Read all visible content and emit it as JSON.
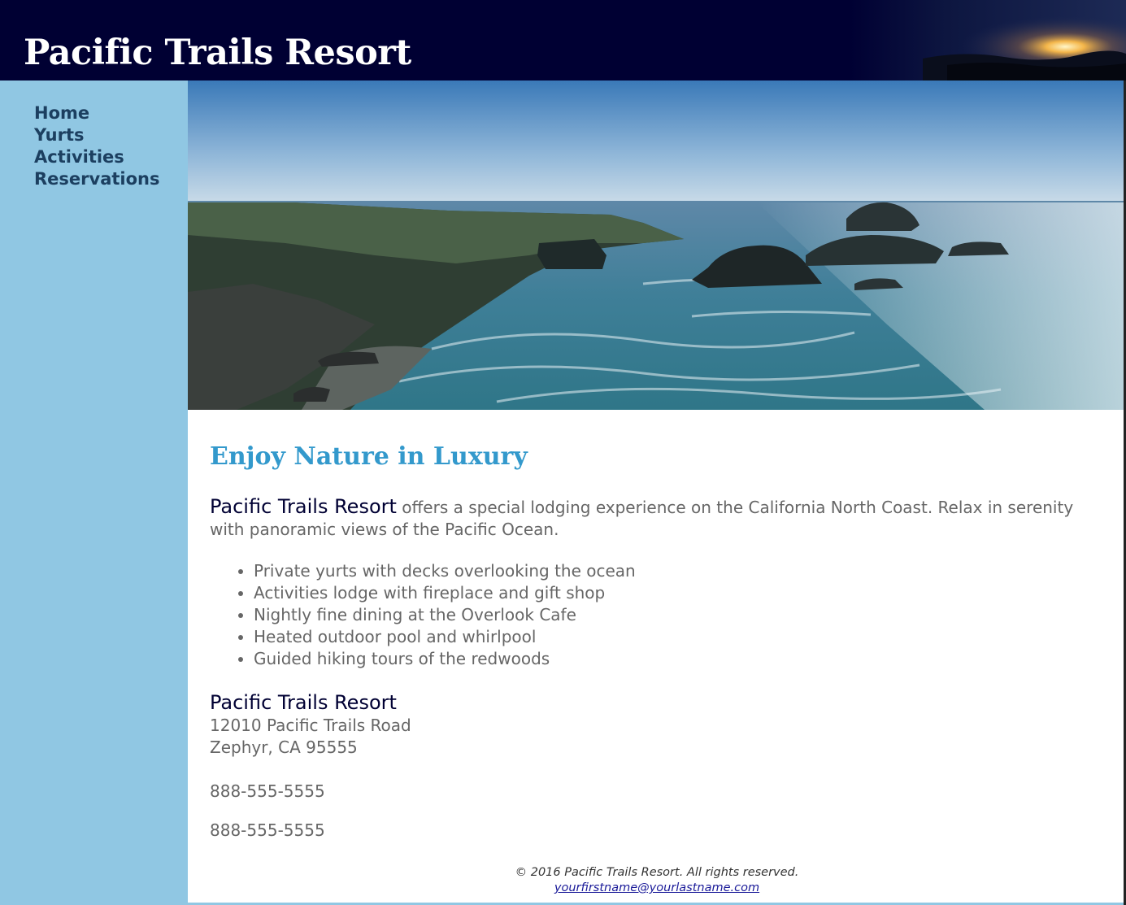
{
  "site": {
    "title": "Pacific Trails Resort"
  },
  "nav": {
    "items": [
      {
        "label": "Home"
      },
      {
        "label": "Yurts"
      },
      {
        "label": "Activities"
      },
      {
        "label": "Reservations"
      }
    ]
  },
  "main": {
    "heading": "Enjoy Nature in Luxury",
    "intro_resort": "Pacific Trails Resort",
    "intro_text": " offers a special lodging experience on the California North Coast. Relax in serenity with panoramic views of the Pacific Ocean.",
    "features": [
      "Private yurts with decks overlooking the ocean",
      "Activities lodge with fireplace and gift shop",
      "Nightly fine dining at the Overlook Cafe",
      "Heated outdoor pool and whirlpool",
      "Guided hiking tours of the redwoods"
    ],
    "contact": {
      "name": "Pacific Trails Resort",
      "street": "12010 Pacific Trails Road",
      "city": "Zephyr, CA 95555",
      "phone": "888-555-5555",
      "phone_repeat": "888-555-5555"
    }
  },
  "footer": {
    "copyright": "© 2016 Pacific Trails Resort. All rights reserved.",
    "email": "yourfirstname@yourlastname.com"
  },
  "colors": {
    "header_bg": "#000033",
    "nav_bg": "#90c7e3",
    "nav_link": "#1c3f60",
    "heading": "#3399cc",
    "body_text": "#666666"
  }
}
